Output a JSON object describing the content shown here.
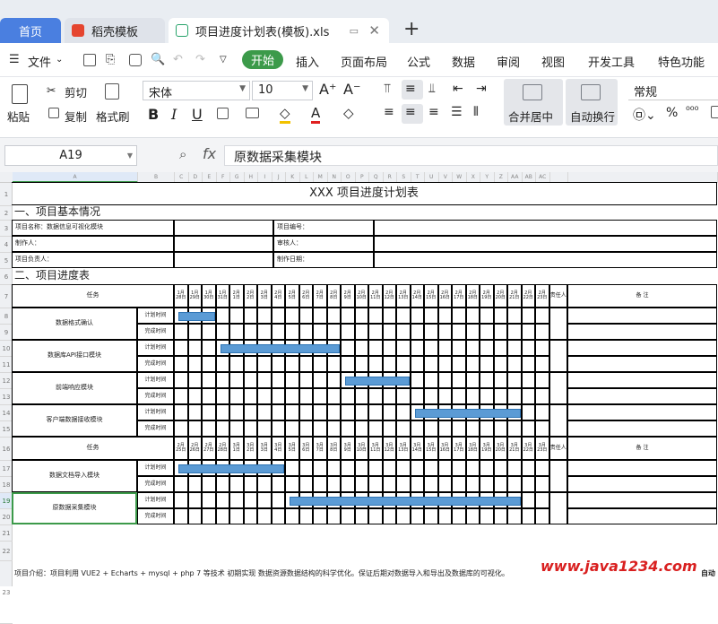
{
  "tabs": {
    "home": "首页",
    "daoke": "稻壳模板",
    "file": "项目进度计划表(模板).xls",
    "plus": "+"
  },
  "menu": {
    "file": "文件",
    "start": "开始",
    "items": [
      "插入",
      "页面布局",
      "公式",
      "数据",
      "审阅",
      "视图",
      "开发工具",
      "特色功能"
    ]
  },
  "ribbon": {
    "paste": "粘贴",
    "cut": "剪切",
    "copy": "复制",
    "format_painter": "格式刷",
    "font": "宋体",
    "size": "10",
    "merge": "合并居中",
    "wrap": "自动换行",
    "number_format": "常规",
    "bold": "B",
    "italic": "I",
    "underline": "U"
  },
  "formula": {
    "cell": "A19",
    "fx": "fx",
    "content": "原数据采集模块"
  },
  "columns": [
    "A",
    "B",
    "C",
    "D",
    "E",
    "F",
    "G",
    "H",
    "I",
    "J",
    "K",
    "L",
    "M",
    "N",
    "O",
    "P",
    "Q",
    "R",
    "S",
    "T",
    "U",
    "V",
    "W",
    "X",
    "Y",
    "Z",
    "AA",
    "AB",
    "AC"
  ],
  "rows": [
    "1",
    "2",
    "3",
    "4",
    "5",
    "6",
    "7",
    "8",
    "9",
    "10",
    "11",
    "12",
    "13",
    "14",
    "15",
    "16",
    "17",
    "18",
    "19",
    "20",
    "21",
    "22",
    "23"
  ],
  "sheet": {
    "title": "XXX 项目进度计划表",
    "section1": "一、项目基本情况",
    "section2": "二、项目进度表",
    "info": [
      [
        "项目名称：数据信息可视化模块",
        "项目编号："
      ],
      [
        "制作人：",
        "审核人："
      ],
      [
        "项目负责人：",
        "制作日期："
      ]
    ],
    "task_header": "任务",
    "owner_header": "责任人",
    "note_header": "备 注",
    "plan": "计划时间",
    "done": "完成时间",
    "dates1": [
      "1月\n28日",
      "1月\n29日",
      "1月\n30日",
      "1月\n31日",
      "2月\n1日",
      "2月\n2日",
      "2月\n3日",
      "2月\n4日",
      "2月\n5日",
      "2月\n6日",
      "2月\n7日",
      "2月\n8日",
      "2月\n9日",
      "2月\n10日",
      "2月\n11日",
      "2月\n12日",
      "2月\n13日",
      "2月\n14日",
      "2月\n15日",
      "2月\n16日",
      "2月\n17日",
      "2月\n18日",
      "2月\n19日",
      "2月\n20日",
      "2月\n21日",
      "2月\n22日",
      "2月\n23日"
    ],
    "dates2": [
      "2月\n25日",
      "2月\n26日",
      "2月\n27日",
      "2月\n28日",
      "3月\n1日",
      "3月\n2日",
      "3月\n3日",
      "3月\n4日",
      "3月\n5日",
      "3月\n6日",
      "3月\n7日",
      "3月\n8日",
      "3月\n9日",
      "3月\n10日",
      "3月\n11日",
      "3月\n12日",
      "3月\n13日",
      "3月\n14日",
      "3月\n15日",
      "3月\n16日",
      "3月\n17日",
      "3月\n18日",
      "3月\n19日",
      "3月\n20日",
      "3月\n21日",
      "3月\n22日",
      "3月\n23日"
    ],
    "tasks1": [
      {
        "name": "数据格式确认",
        "bar_start": 0,
        "bar_span": 3
      },
      {
        "name": "数据库API接口模块",
        "bar_start": 3,
        "bar_span": 9
      },
      {
        "name": "前端响应模块",
        "bar_start": 12,
        "bar_span": 5
      },
      {
        "name": "客户端数据接收模块",
        "bar_start": 17,
        "bar_span": 8
      }
    ],
    "tasks2": [
      {
        "name": "数据文档导入模块",
        "bar_start": 0,
        "bar_span": 8
      },
      {
        "name": "原数据采集模块",
        "bar_start": 8,
        "bar_span": 17
      }
    ],
    "intro": "项目介绍：项目利用 VUE2 + Echarts + mysql + php 7 等技术 初期实现 数据资源数据结构的科学优化。保证后期对数据导入和导出及数据库的可视化。",
    "intro_end": "自动"
  },
  "watermark": "www.java1234.com"
}
